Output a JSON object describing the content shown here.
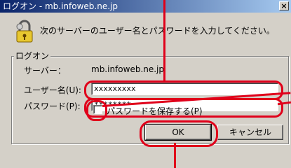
{
  "window": {
    "title": "ログオン - mb.infoweb.ne.jp",
    "close_label": "×"
  },
  "prompt": "次のサーバーのユーザー名とパスワードを入力してください。",
  "group": {
    "label": "ログオン",
    "server_label": "サーバー：",
    "server_value": "mb.infoweb.ne.jp",
    "username_label": "ユーザー名(U):",
    "username_value": "xxxxxxxxx",
    "password_label": "パスワード(P):",
    "password_value": "********",
    "save_password_label": "パスワードを保存する(P)",
    "save_password_checked": false
  },
  "buttons": {
    "ok": "OK",
    "cancel": "キャンセル"
  },
  "colors": {
    "annotation": "#e0001a",
    "titlebar_start": "#0a246a",
    "titlebar_end": "#a6caf0"
  },
  "icons": {
    "dialog": "key-lock-icon",
    "close": "close-icon"
  }
}
